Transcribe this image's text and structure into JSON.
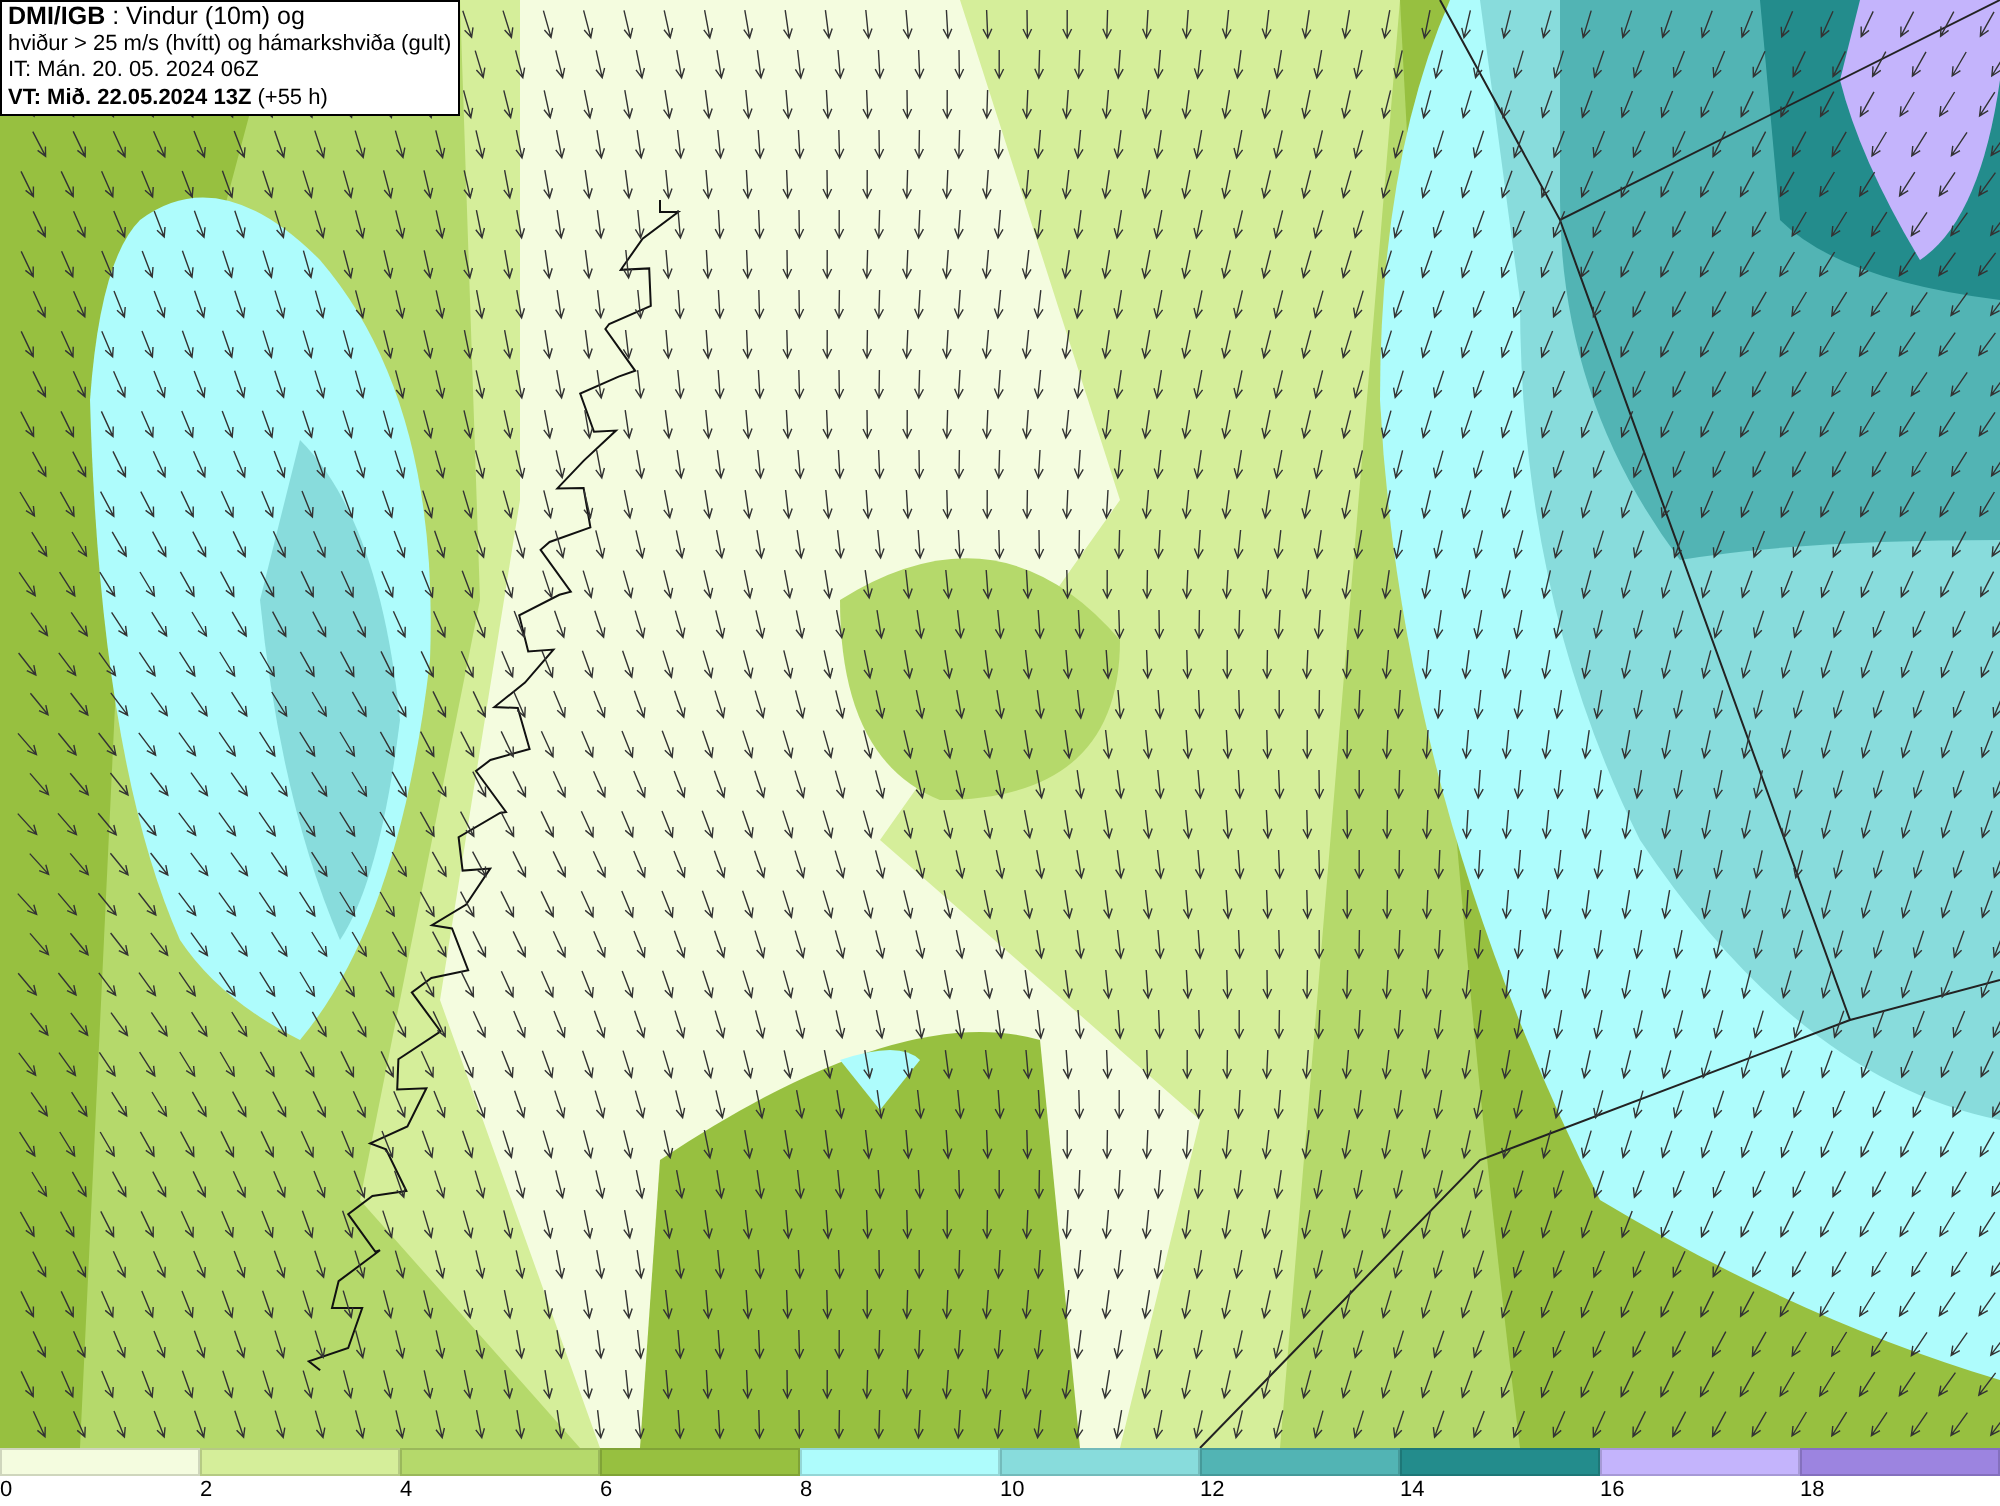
{
  "header": {
    "lines": [
      "**DMI/IGB** : Vindur (10m) og",
      "hviður > 25 m/s (hvítt) og hámarkshviða (gult)",
      "IT: Mán. 20. 05. 2024 06Z",
      "**VT: Mið. 22.05.2024 13Z** (+55 h)"
    ]
  },
  "legend": [
    {
      "label": "0",
      "color": "#f4fcdf"
    },
    {
      "label": "2",
      "color": "#d5ee9a"
    },
    {
      "label": "4",
      "color": "#b5d96b"
    },
    {
      "label": "6",
      "color": "#97c040"
    },
    {
      "label": "8",
      "color": "#aefcfc"
    },
    {
      "label": "10",
      "color": "#88dcdc"
    },
    {
      "label": "12",
      "color": "#52b4b4"
    },
    {
      "label": "14",
      "color": "#238c8c"
    },
    {
      "label": "16",
      "color": "#c4b4fc"
    },
    {
      "label": "18",
      "color": "#9c84e0"
    }
  ]
}
